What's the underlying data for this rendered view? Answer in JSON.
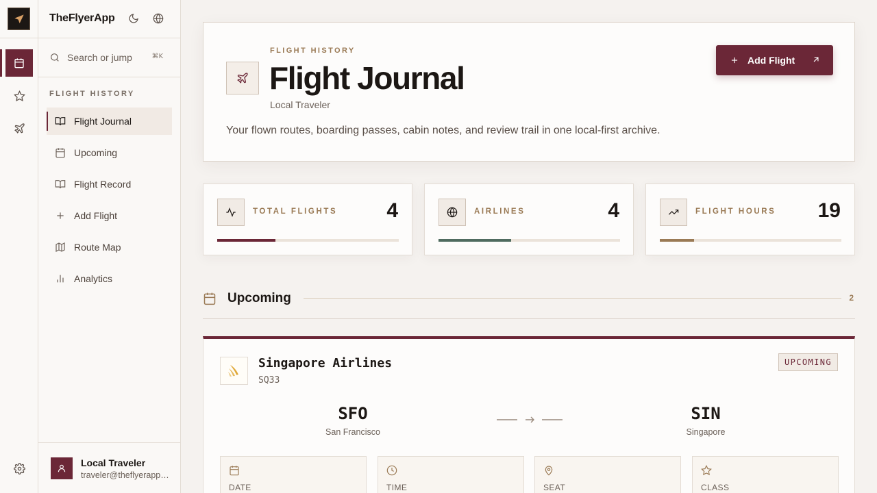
{
  "app": {
    "name": "TheFlyerApp"
  },
  "search": {
    "placeholder": "Search or jump",
    "shortcut": "⌘K"
  },
  "sidebar": {
    "section_label": "FLIGHT HISTORY",
    "items": [
      {
        "label": "Flight Journal",
        "icon": "book-icon",
        "active": true
      },
      {
        "label": "Upcoming",
        "icon": "calendar-icon"
      },
      {
        "label": "Flight Record",
        "icon": "book-open-icon"
      },
      {
        "label": "Add Flight",
        "icon": "plus-icon"
      },
      {
        "label": "Route Map",
        "icon": "map-icon"
      },
      {
        "label": "Analytics",
        "icon": "bar-chart-icon"
      }
    ]
  },
  "user": {
    "name": "Local Traveler",
    "email": "traveler@theflyerapp.local"
  },
  "hero": {
    "eyebrow": "FLIGHT HISTORY",
    "title": "Flight Journal",
    "subtitle": "Local Traveler",
    "description": "Your flown routes, boarding passes, cabin notes, and review trail in one local-first archive.",
    "add_button_label": "Add Flight"
  },
  "stats": [
    {
      "label": "TOTAL FLIGHTS",
      "value": "4",
      "progress": 0.32,
      "color": "#6b2737",
      "icon": "activity-icon"
    },
    {
      "label": "AIRLINES",
      "value": "4",
      "progress": 0.4,
      "color": "#4f6b5f",
      "icon": "globe-icon"
    },
    {
      "label": "FLIGHT HOURS",
      "value": "19",
      "progress": 0.19,
      "color": "#9a7a55",
      "icon": "trending-up-icon"
    }
  ],
  "upcoming": {
    "title": "Upcoming",
    "count": "2",
    "card": {
      "airline": "Singapore Airlines",
      "flight_number": "SQ33",
      "status": "UPCOMING",
      "origin": {
        "code": "SFO",
        "city": "San Francisco"
      },
      "destination": {
        "code": "SIN",
        "city": "Singapore"
      },
      "details": [
        {
          "label": "DATE",
          "icon": "calendar-icon"
        },
        {
          "label": "TIME",
          "icon": "clock-icon"
        },
        {
          "label": "SEAT",
          "icon": "map-pin-icon"
        },
        {
          "label": "CLASS",
          "icon": "star-icon"
        }
      ]
    }
  },
  "colors": {
    "accent": "#6b2737",
    "gold": "#9a7a55",
    "sage": "#4f6b5f"
  }
}
